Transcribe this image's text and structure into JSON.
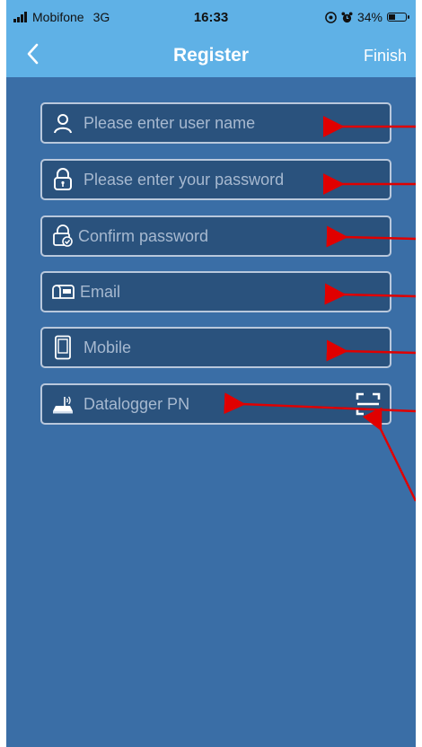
{
  "status_bar": {
    "carrier": "Mobifone",
    "network": "3G",
    "time": "16:33",
    "battery": "34%"
  },
  "nav": {
    "back_icon": "chevron-left",
    "title": "Register",
    "finish_label": "Finish"
  },
  "form": {
    "username": {
      "placeholder": "Please enter user name",
      "icon": "user-icon"
    },
    "password": {
      "placeholder": "Please enter your password",
      "icon": "lock-icon"
    },
    "confirm": {
      "placeholder": "Confirm password",
      "icon": "lock-check-icon"
    },
    "email": {
      "placeholder": "Email",
      "icon": "mailbox-icon"
    },
    "mobile": {
      "placeholder": "Mobile",
      "icon": "phone-icon"
    },
    "datalogger": {
      "placeholder": "Datalogger PN",
      "icon": "router-icon",
      "scan_icon": "scan-icon"
    }
  },
  "colors": {
    "background": "#3a6ea6",
    "header": "#5fb1e6",
    "field_bg": "#2a527d",
    "field_border": "#b9c8dc",
    "annotation_arrow": "#e00000"
  }
}
